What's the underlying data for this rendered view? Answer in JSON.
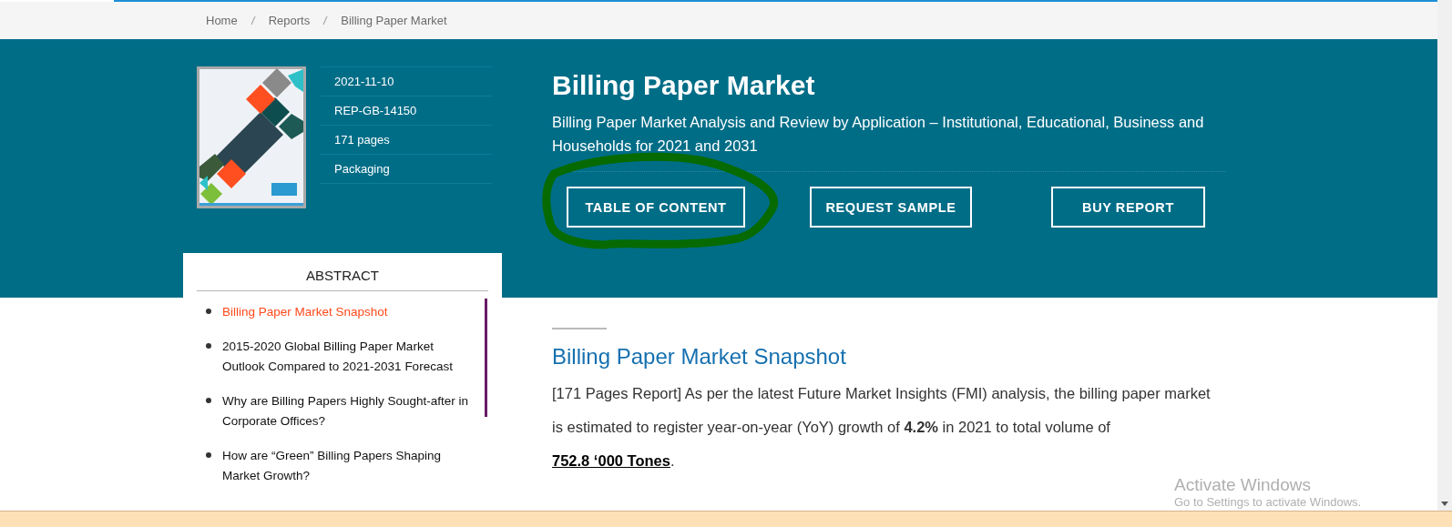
{
  "breadcrumb": [
    {
      "label": "Home"
    },
    {
      "label": "Reports"
    },
    {
      "label": "Billing Paper Market"
    }
  ],
  "report": {
    "meta": [
      "2021-11-10",
      "REP-GB-14150",
      "171 pages",
      "Packaging"
    ],
    "title": "Billing Paper Market",
    "subtitle": "Billing Paper Market Analysis and Review by Application – Institutional, Educational, Business and Households for 2021 and 2031"
  },
  "buttons": [
    {
      "label": "TABLE OF CONTENT",
      "annotated": true
    },
    {
      "label": "REQUEST SAMPLE",
      "annotated": false
    },
    {
      "label": "BUY REPORT",
      "annotated": false
    }
  ],
  "abstract": {
    "title": "ABSTRACT",
    "items": [
      {
        "label": "Billing Paper Market Snapshot",
        "selected": true
      },
      {
        "label": "2015-2020 Global Billing Paper Market Outlook Compared to 2021-2031 Forecast",
        "selected": false
      },
      {
        "label": "Why are Billing Papers Highly Sought-after in Corporate Offices?",
        "selected": false
      },
      {
        "label": "How are “Green” Billing Papers Shaping Market Growth?",
        "selected": false
      }
    ]
  },
  "article": {
    "heading": "Billing Paper Market Snapshot",
    "text": "[171 Pages Report] As per the latest Future Market Insights (FMI) analysis, the billing paper market is estimated to register year-on-year (YoY) growth of **4.2%** in 2021 to total volume of",
    "link": "752.8 ‘000 Tones",
    "text_end": "."
  },
  "os_notice": {
    "title": "Activate Windows",
    "hint": "Go to Settings to activate Windows."
  }
}
